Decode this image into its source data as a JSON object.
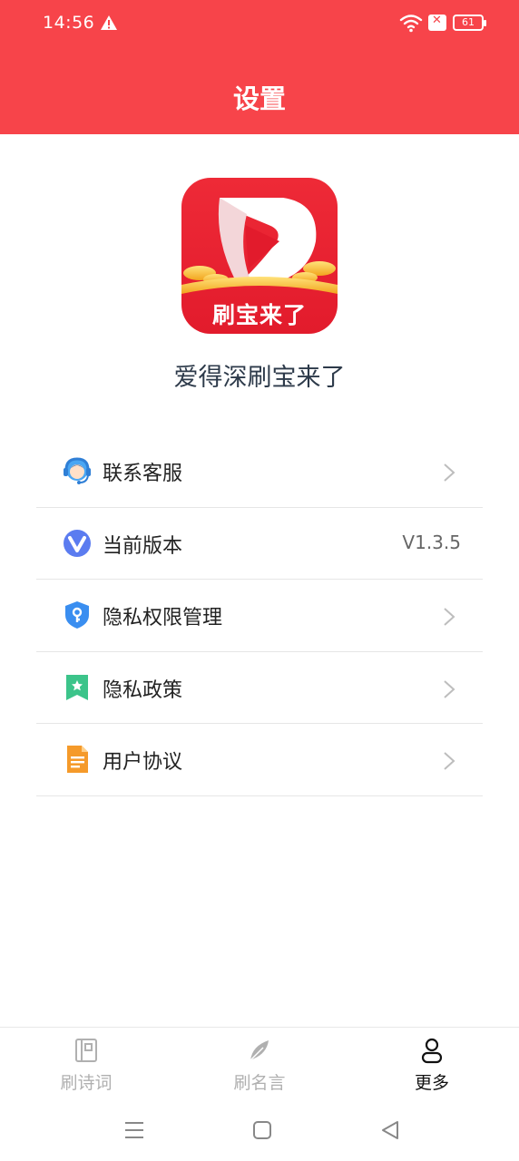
{
  "status_bar": {
    "time": "14:56",
    "battery": "61"
  },
  "header": {
    "title": "设置"
  },
  "app": {
    "logo_text": "刷宝来了",
    "name": "爱得深刷宝来了"
  },
  "menu": [
    {
      "label": "联系客服",
      "icon": "customer-service-icon"
    },
    {
      "label": "当前版本",
      "value": "V1.3.5",
      "icon": "version-icon"
    },
    {
      "label": "隐私权限管理",
      "icon": "privacy-shield-icon"
    },
    {
      "label": "隐私政策",
      "icon": "bookmark-icon"
    },
    {
      "label": "用户协议",
      "icon": "document-icon"
    }
  ],
  "tabs": [
    {
      "label": "刷诗词",
      "icon": "book-icon",
      "active": false
    },
    {
      "label": "刷名言",
      "icon": "feather-icon",
      "active": false
    },
    {
      "label": "更多",
      "icon": "user-icon",
      "active": true
    }
  ],
  "colors": {
    "brand": "#f7444a",
    "text": "#222222",
    "inactive": "#b0b0b0"
  }
}
